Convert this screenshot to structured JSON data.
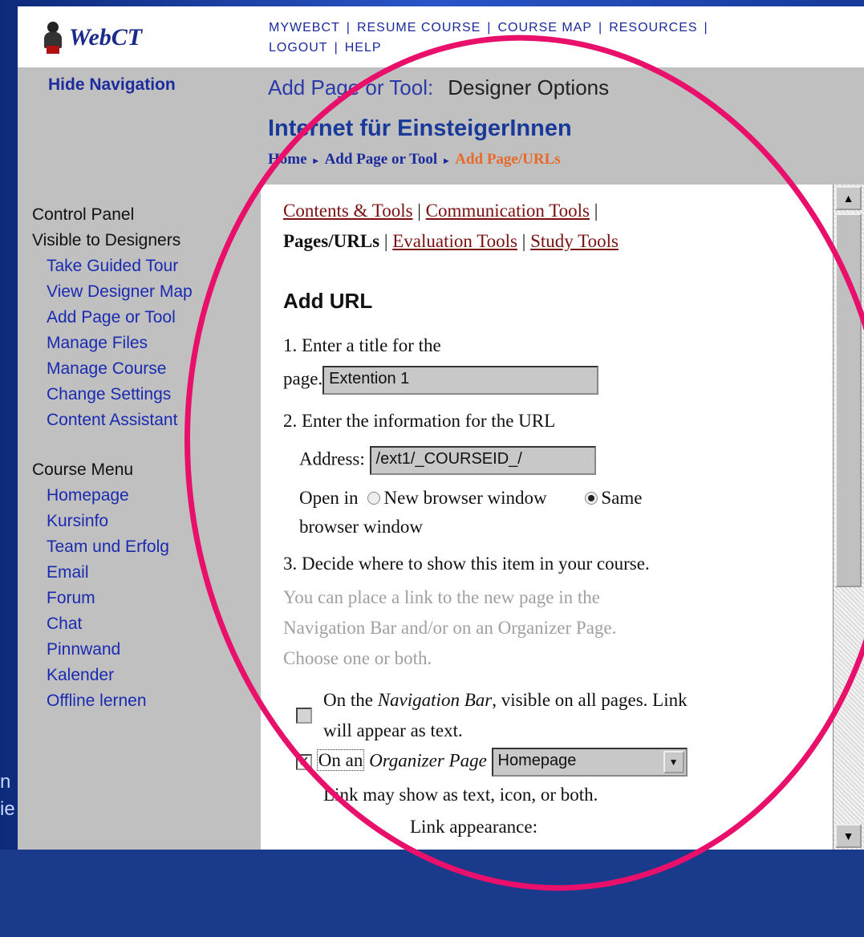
{
  "slide": {
    "bottom_text_1": "n",
    "bottom_text_2": "ie"
  },
  "app": {
    "logo_text": "WebCT"
  },
  "topnav": [
    "MYWEBCT",
    "RESUME COURSE",
    "COURSE MAP",
    "RESOURCES",
    "LOGOUT",
    "HELP"
  ],
  "header": {
    "hide_nav": "Hide Navigation",
    "section": "Add Page or Tool:",
    "subsection": "Designer Options",
    "course_title": "Internet für EinsteigerInnen"
  },
  "breadcrumb": {
    "home": "Home",
    "parent": "Add Page or Tool",
    "current": "Add Page/URLs"
  },
  "leftnav": {
    "control_panel": "Control Panel",
    "visible": "Visible to Designers",
    "designer_items": [
      "Take Guided Tour",
      "View Designer Map",
      "Add Page or Tool",
      "Manage Files",
      "Manage Course",
      "Change Settings",
      "Content Assistant"
    ],
    "course_menu": "Course Menu",
    "course_items": [
      "Homepage",
      "Kursinfo",
      "Team und Erfolg",
      "Email",
      "Forum",
      "Chat",
      "Pinnwand",
      "Kalender",
      "Offline lernen"
    ]
  },
  "tools": {
    "contents": "Contents & Tools",
    "communication": "Communication Tools",
    "pages": "Pages/URLs",
    "evaluation": "Evaluation Tools",
    "study": "Study Tools"
  },
  "form": {
    "heading": "Add URL",
    "step1": "1. Enter a title for the",
    "step1_label": "page.",
    "title_value": "Extention 1",
    "step2": "2. Enter the information for the URL",
    "address_label": "Address:",
    "address_value": "/ext1/_COURSEID_/",
    "open_in": "Open in",
    "new_window": "New browser window",
    "same_window": "Same",
    "same_window_2": "browser window",
    "step3": "3. Decide where to show this item in your course.",
    "hint_1": "You can place a link to the new page in the",
    "hint_2": "Navigation Bar and/or on an Organizer Page.",
    "hint_3": "Choose one or both.",
    "nav_bar_1": "On the",
    "nav_bar_em": "Navigation Bar",
    "nav_bar_2": ", visible on all pages. Link",
    "nav_bar_3": "will appear as text.",
    "org_1": "On an",
    "org_em": "Organizer Page",
    "org_select": "Homepage",
    "org_2": "Link may show as text, icon, or both.",
    "link_appearance": "Link appearance:"
  },
  "colors": {
    "accent_ring": "#e8106a",
    "link": "#7a1010",
    "nav": "#1a2ab0"
  }
}
